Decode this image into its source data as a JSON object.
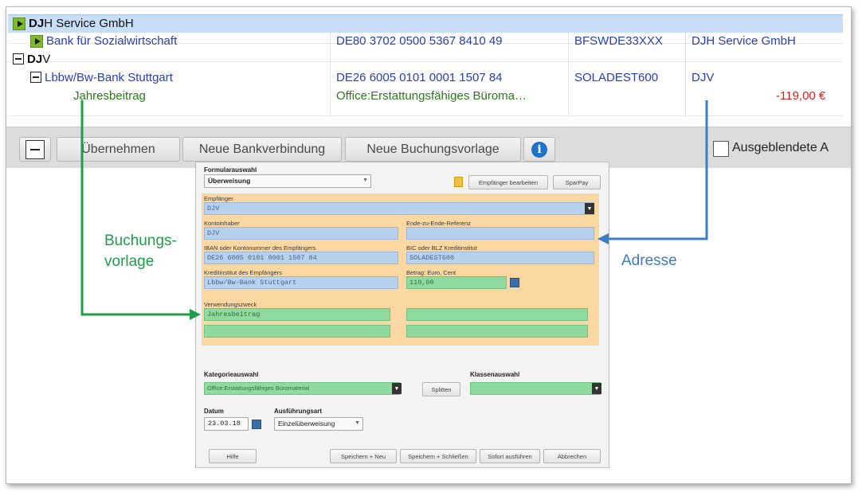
{
  "tree": {
    "rows": [
      {
        "name": "DJH Service GmbH",
        "name_prefix": "DJ",
        "name_suffix": "H Service GmbH"
      },
      {
        "bank": "Bank für Sozialwirtschaft",
        "iban": "DE80 3702 0500 5367 8410 49",
        "bic": "BFSWDE33XXX",
        "owner": "DJH Service GmbH"
      },
      {
        "name_prefix": "DJ",
        "name_suffix": "V"
      },
      {
        "bank": "Lbbw/Bw-Bank Stuttgart",
        "iban": "DE26 6005 0101 0001 1507 84",
        "bic": "SOLADEST600",
        "owner": "DJV"
      },
      {
        "purpose": "Jahresbeitrag",
        "category": "Office:Erstattungsfähiges Büroma…",
        "amount": "-119,00 €"
      }
    ]
  },
  "toolbar": {
    "apply": "Übernehmen",
    "new_bank": "Neue Bankverbindung",
    "new_template": "Neue Buchungsvorlage",
    "hidden_label": "Ausgeblendete A"
  },
  "dialog": {
    "form_select_label": "Formularauswahl",
    "form_select_value": "Überweisung",
    "edit_recipient": "Empfänger bearbeiten",
    "sparpay": "SparPay",
    "recipient_label": "Empfänger",
    "recipient_value": "DJV",
    "account_holder_label": "Kontoinhaber",
    "account_holder_value": "DJV",
    "e2e_label": "Ende-zu-Ende-Referenz",
    "e2e_value": "",
    "iban_label": "IBAN oder Kontonummer des Empfängers",
    "iban_value": "DE26 6005 0101 0001 1507 84",
    "bic_label": "BIC oder BLZ Kreditinstitut",
    "bic_value": "SOLADEST600",
    "bank_label": "Kreditinstitut des Empfängers",
    "bank_value": "Lbbw/Bw-Bank Stuttgart",
    "amount_label": "Betrag: Euro, Cent",
    "amount_value": "119,00",
    "purpose_label": "Verwendungszweck",
    "purpose_value": "Jahresbeitrag",
    "category_label": "Kategorieauswahl",
    "category_value": "Office:Erstattungsfähiges Büromaterial",
    "split": "Splitten",
    "class_label": "Klassenauswahl",
    "class_value": "",
    "date_label": "Datum",
    "date_value": "23.03.18",
    "exec_label": "Ausführungsart",
    "exec_value": "Einzelüberweisung",
    "help": "Hilfe",
    "save_new": "Speichern + Neu",
    "save_close": "Speichern + Schließen",
    "execute_now": "Sofort ausführen",
    "cancel": "Abbrechen"
  },
  "annotations": {
    "green_label": "Buchungs-\nvorlage",
    "blue_label": "Adresse"
  },
  "colors": {
    "selection": "#c8ddf7",
    "link_blue": "#2a3fb0",
    "green_text": "#2b7a1a",
    "red_amount": "#d62020",
    "annotation_green": "#1f9c4a",
    "annotation_blue": "#3c7dc0",
    "form_orange": "#fbd8a1",
    "field_blue": "#b7d1ef",
    "field_green": "#8fdb9f"
  },
  "icons": [
    "expand-play-icon",
    "collapse-minus-icon",
    "info-icon",
    "dropdown-arrow-icon",
    "calendar-icon",
    "notification-icon"
  ]
}
